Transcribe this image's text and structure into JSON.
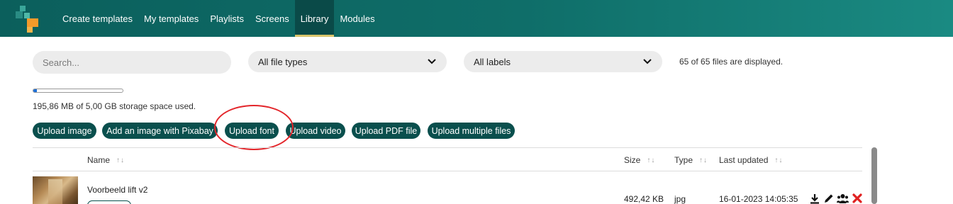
{
  "nav": {
    "items": [
      {
        "label": "Create templates"
      },
      {
        "label": "My templates"
      },
      {
        "label": "Playlists"
      },
      {
        "label": "Screens"
      },
      {
        "label": "Library",
        "active": true
      },
      {
        "label": "Modules"
      }
    ]
  },
  "filters": {
    "search_placeholder": "Search...",
    "file_type": "All file types",
    "labels": "All labels",
    "files_displayed": "65 of 65 files are displayed."
  },
  "storage": {
    "used_fraction": 0.04,
    "text": "195,86  MB of 5,00 GB storage space used."
  },
  "buttons": {
    "upload_image": "Upload image",
    "pixabay": "Add an image with  Pixabay",
    "upload_font": "Upload font",
    "upload_video": "Upload video",
    "upload_pdf": "Upload  PDF file",
    "upload_multiple": "Upload multiple files"
  },
  "table": {
    "headers": {
      "name": "Name",
      "size": "Size",
      "type": "Type",
      "updated": "Last updated",
      "sort_glyph": "↑↓"
    },
    "rows": [
      {
        "name": "Voorbeeld lift v2",
        "size": "492,42  KB",
        "type": "jpg",
        "updated": "16-01-2023 14:05:35"
      }
    ]
  },
  "icons": [
    "download-icon",
    "pencil-icon",
    "users-icon",
    "delete-icon"
  ],
  "colors": {
    "brand": "#0a4f4d",
    "accent_underline": "#d9c46a",
    "annotation": "#e3262b",
    "delete": "#e02020"
  }
}
